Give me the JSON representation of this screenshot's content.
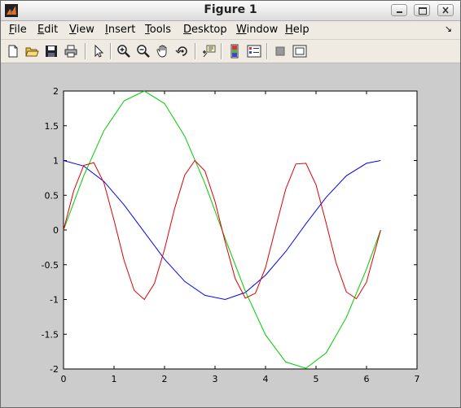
{
  "window": {
    "title": "Figure 1"
  },
  "menu": [
    {
      "label": "File",
      "ul": "F",
      "rest": "ile"
    },
    {
      "label": "Edit",
      "ul": "E",
      "rest": "dit"
    },
    {
      "label": "View",
      "ul": "V",
      "rest": "iew"
    },
    {
      "label": "Insert",
      "ul": "I",
      "rest": "nsert"
    },
    {
      "label": "Tools",
      "ul": "T",
      "rest": "ools"
    },
    {
      "label": "Desktop",
      "ul": "D",
      "rest": "esktop"
    },
    {
      "label": "Window",
      "ul": "W",
      "rest": "indow"
    },
    {
      "label": "Help",
      "ul": "H",
      "rest": "elp"
    }
  ],
  "toolbar": [
    "new-figure-icon",
    "open-file-icon",
    "save-icon",
    "print-icon",
    "edit-plot-arrow-icon",
    "zoom-in-icon",
    "zoom-out-icon",
    "pan-hand-icon",
    "rotate-3d-icon",
    "data-cursor-icon",
    "insert-colorbar-icon",
    "insert-legend-icon",
    "hide-plot-tools-icon",
    "show-plot-tools-icon"
  ],
  "chart_data": {
    "type": "line",
    "title": "",
    "xlabel": "",
    "ylabel": "",
    "xlim": [
      0,
      7
    ],
    "ylim": [
      -2,
      2
    ],
    "xticks": [
      "0",
      "1",
      "2",
      "3",
      "4",
      "5",
      "6",
      "7"
    ],
    "yticks": [
      "2",
      "1.5",
      "1",
      "0.5",
      "0",
      "-0.5",
      "-1",
      "-1.5",
      "-2"
    ],
    "grid": false,
    "series": [
      {
        "color": "#0000ff",
        "x": [
          0,
          0.4,
          0.8,
          1.2,
          1.6,
          2.0,
          2.4,
          2.8,
          3.2,
          3.6,
          4.0,
          4.4,
          4.8,
          5.2,
          5.6,
          6.0,
          6.28
        ],
        "y": [
          1,
          0.92,
          0.7,
          0.36,
          -0.03,
          -0.42,
          -0.74,
          -0.94,
          -1,
          -0.9,
          -0.65,
          -0.31,
          0.09,
          0.47,
          0.78,
          0.96,
          1
        ]
      },
      {
        "color": "#00cc00",
        "x": [
          0,
          0.4,
          0.8,
          1.2,
          1.6,
          2.0,
          2.4,
          2.8,
          3.2,
          3.6,
          4.0,
          4.4,
          4.8,
          5.2,
          5.6,
          6.0,
          6.28
        ],
        "y": [
          0,
          0.78,
          1.43,
          1.86,
          2,
          1.82,
          1.35,
          0.67,
          -0.12,
          -0.88,
          -1.51,
          -1.9,
          -1.99,
          -1.77,
          -1.26,
          -0.56,
          0
        ]
      },
      {
        "color": "#dd0000",
        "x": [
          0,
          0.2,
          0.4,
          0.6,
          0.8,
          1.0,
          1.2,
          1.4,
          1.6,
          1.8,
          2.0,
          2.2,
          2.4,
          2.6,
          2.8,
          3.0,
          3.2,
          3.4,
          3.6,
          3.8,
          4.0,
          4.2,
          4.4,
          4.6,
          4.8,
          5.0,
          5.2,
          5.4,
          5.6,
          5.8,
          6.0,
          6.28
        ],
        "y": [
          0,
          0.56,
          0.93,
          0.97,
          0.68,
          0.14,
          -0.44,
          -0.87,
          -1,
          -0.77,
          -0.28,
          0.31,
          0.79,
          1,
          0.85,
          0.41,
          -0.17,
          -0.7,
          -0.98,
          -0.91,
          -0.54,
          0.03,
          0.59,
          0.95,
          0.96,
          0.65,
          0.1,
          -0.48,
          -0.89,
          -0.99,
          -0.75,
          0
        ]
      }
    ]
  }
}
